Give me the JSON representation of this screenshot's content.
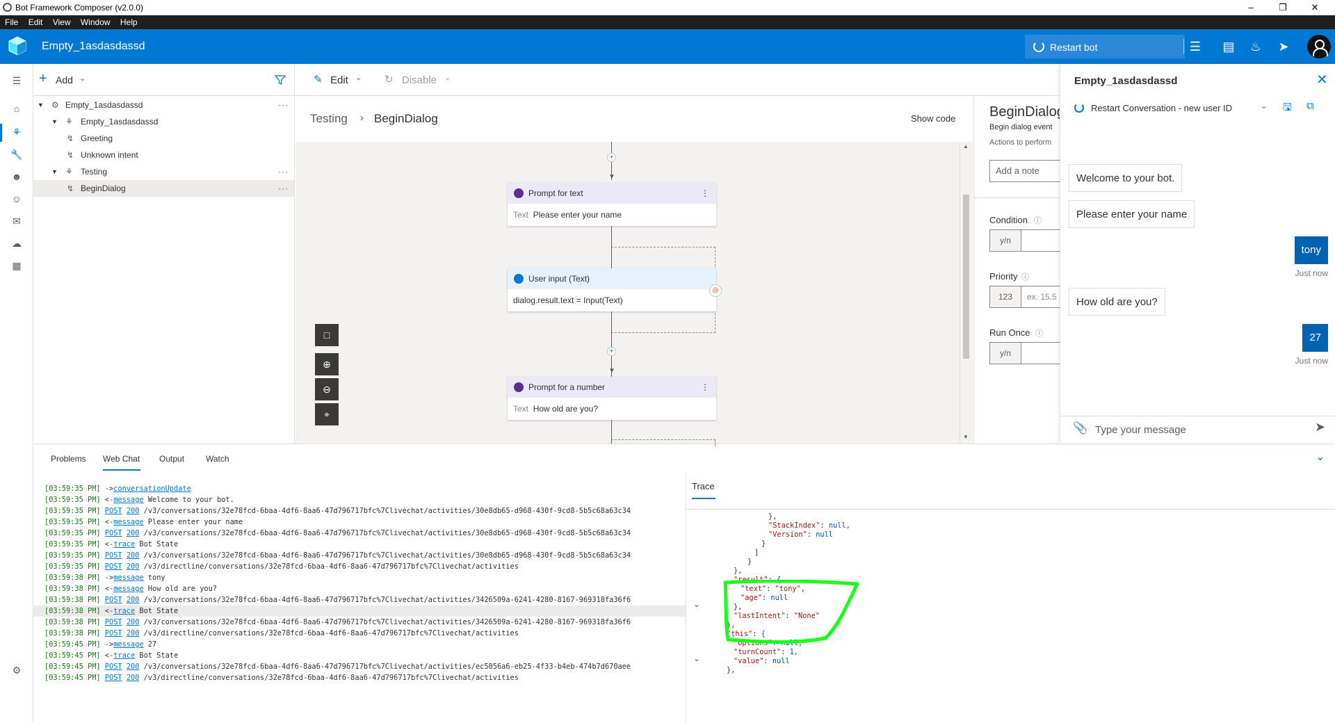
{
  "window": {
    "title": "Bot Framework Composer (v2.0.0)"
  },
  "menu": [
    "File",
    "Edit",
    "View",
    "Window",
    "Help"
  ],
  "header": {
    "project": "Empty_1asdasdassd",
    "restart_label": "Restart bot"
  },
  "tree": {
    "add_label": "Add",
    "items": [
      {
        "label": "Empty_1asdasdassd",
        "level": 0
      },
      {
        "label": "Empty_1asdasdassd",
        "level": 1
      },
      {
        "label": "Greeting",
        "level": 2
      },
      {
        "label": "Unknown intent",
        "level": 2
      },
      {
        "label": "Testing",
        "level": 1
      },
      {
        "label": "BeginDialog",
        "level": 2
      }
    ]
  },
  "canvas_toolbar": {
    "edit_label": "Edit",
    "disable_label": "Disable"
  },
  "breadcrumb": {
    "parent": "Testing",
    "current": "BeginDialog",
    "show_code": "Show code"
  },
  "nodes": [
    {
      "title": "Prompt for text",
      "field": "Text",
      "value": "Please enter your name"
    },
    {
      "title": "User input (Text)",
      "value": "dialog.result.text = Input(Text)"
    },
    {
      "title": "Prompt for a number",
      "field": "Text",
      "value": "How old are you?"
    }
  ],
  "properties": {
    "title": "BeginDialog",
    "subtitle": "Begin dialog event",
    "description": "Actions to perform",
    "note_placeholder": "Add a note",
    "condition_label": "Condition",
    "priority_label": "Priority",
    "priority_type": "123",
    "priority_placeholder": "ex. 15.5",
    "run_once_label": "Run Once",
    "yn": "y/n"
  },
  "chat": {
    "title": "Empty_1asdasdassd",
    "restart_label": "Restart Conversation - new user ID",
    "messages": [
      {
        "from": "bot",
        "text": "Welcome to your bot."
      },
      {
        "from": "bot",
        "text": "Please enter your name"
      },
      {
        "from": "user",
        "text": "tony",
        "time": "Just now"
      },
      {
        "from": "bot",
        "text": "How old are you?"
      },
      {
        "from": "user",
        "text": "27",
        "time": "Just now"
      }
    ],
    "input_placeholder": "Type your message"
  },
  "bottom_tabs": [
    "Problems",
    "Web Chat",
    "Output",
    "Watch"
  ],
  "log": [
    {
      "ts": "[03:59:35 PM]",
      "dir": "->",
      "link": "conversationUpdate",
      "text": ""
    },
    {
      "ts": "[03:59:35 PM]",
      "dir": "<-",
      "link": "message",
      "text": " Welcome to your bot."
    },
    {
      "ts": "[03:59:35 PM]",
      "dir": "",
      "link": "POST",
      "code": "200",
      "text": " /v3/conversations/32e78fcd-6baa-4df6-8aa6-47d796717bfc%7Clivechat/activities/30e8db65-d968-430f-9cd8-5b5c68a63c34"
    },
    {
      "ts": "[03:59:35 PM]",
      "dir": "<-",
      "link": "message",
      "text": " Please enter your name"
    },
    {
      "ts": "[03:59:35 PM]",
      "dir": "",
      "link": "POST",
      "code": "200",
      "text": " /v3/conversations/32e78fcd-6baa-4df6-8aa6-47d796717bfc%7Clivechat/activities/30e8db65-d968-430f-9cd8-5b5c68a63c34"
    },
    {
      "ts": "[03:59:35 PM]",
      "dir": "<-",
      "link": "trace",
      "text": " Bot State"
    },
    {
      "ts": "[03:59:35 PM]",
      "dir": "",
      "link": "POST",
      "code": "200",
      "text": " /v3/conversations/32e78fcd-6baa-4df6-8aa6-47d796717bfc%7Clivechat/activities/30e8db65-d968-430f-9cd8-5b5c68a63c34"
    },
    {
      "ts": "[03:59:35 PM]",
      "dir": "",
      "link": "POST",
      "code": "200",
      "text": " /v3/directline/conversations/32e78fcd-6baa-4df6-8aa6-47d796717bfc%7Clivechat/activities"
    },
    {
      "ts": "[03:59:38 PM]",
      "dir": "->",
      "link": "message",
      "text": " tony"
    },
    {
      "ts": "[03:59:38 PM]",
      "dir": "<-",
      "link": "message",
      "text": " How old are you?"
    },
    {
      "ts": "[03:59:38 PM]",
      "dir": "",
      "link": "POST",
      "code": "200",
      "text": " /v3/conversations/32e78fcd-6baa-4df6-8aa6-47d796717bfc%7Clivechat/activities/3426509a-6241-4280-8167-969318fa36f6"
    },
    {
      "ts": "[03:59:38 PM]",
      "dir": "<-",
      "link": "trace",
      "text": " Bot State",
      "highlight": true
    },
    {
      "ts": "[03:59:38 PM]",
      "dir": "",
      "link": "POST",
      "code": "200",
      "text": " /v3/conversations/32e78fcd-6baa-4df6-8aa6-47d796717bfc%7Clivechat/activities/3426509a-6241-4280-8167-969318fa36f6"
    },
    {
      "ts": "[03:59:38 PM]",
      "dir": "",
      "link": "POST",
      "code": "200",
      "text": " /v3/directline/conversations/32e78fcd-6baa-4df6-8aa6-47d796717bfc%7Clivechat/activities"
    },
    {
      "ts": "[03:59:45 PM]",
      "dir": "->",
      "link": "message",
      "text": " 27"
    },
    {
      "ts": "[03:59:45 PM]",
      "dir": "<-",
      "link": "trace",
      "text": " Bot State"
    },
    {
      "ts": "[03:59:45 PM]",
      "dir": "",
      "link": "POST",
      "code": "200",
      "text": " /v3/conversations/32e78fcd-6baa-4df6-8aa6-47d796717bfc%7Clivechat/activities/ec5056a6-eb25-4f33-b4eb-474b7d670aee"
    },
    {
      "ts": "[03:59:45 PM]",
      "dir": "",
      "link": "POST",
      "code": "200",
      "text": " /v3/directline/conversations/32e78fcd-6baa-4df6-8aa6-47d796717bfc%7Clivechat/activities"
    }
  ],
  "trace": {
    "tab": "Trace",
    "lines": [
      "},",
      "\"StackIndex\": null,",
      "\"Version\": null",
      "}",
      "]",
      "}",
      "},",
      "\"result\": {",
      "\"text\": \"tony\",",
      "\"age\": null",
      "},",
      "\"lastIntent\": \"None\"",
      "},",
      "\"this\": {",
      "\"options\": null,",
      "\"turnCount\": 1,",
      "\"value\": null",
      "},"
    ]
  },
  "colors": {
    "accent": "#0078d4",
    "highlight_annotation": "#1aff1a"
  }
}
